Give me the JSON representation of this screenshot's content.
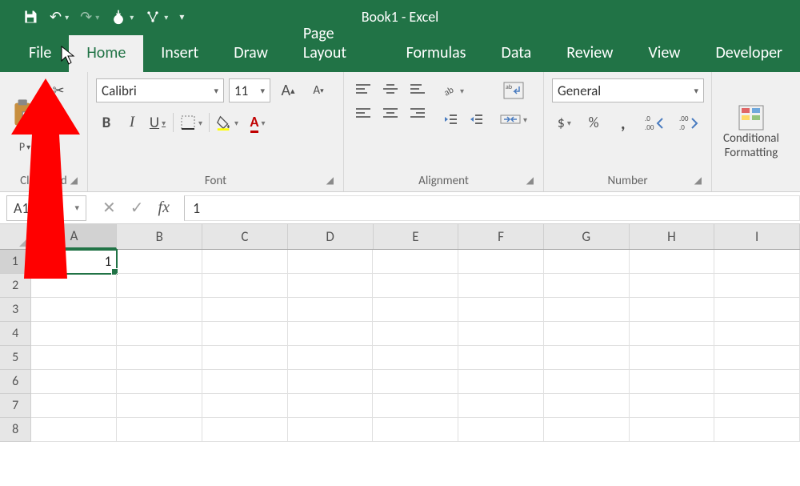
{
  "app": {
    "title": "Book1  -  Excel"
  },
  "tabs": {
    "file": "File",
    "list": [
      "Home",
      "Insert",
      "Draw",
      "Page Layout",
      "Formulas",
      "Data",
      "Review",
      "View",
      "Developer"
    ],
    "active": "Home"
  },
  "ribbon": {
    "clipboard": {
      "label": "Clipboard"
    },
    "font": {
      "label": "Font",
      "name": "Calibri",
      "size": "11",
      "increase": "A",
      "decrease": "A",
      "bold": "B",
      "italic": "I",
      "underline": "U"
    },
    "alignment": {
      "label": "Alignment"
    },
    "number": {
      "label": "Number",
      "format": "General",
      "currency": "$",
      "percent": "%",
      "comma": ",",
      "inc": ".0←.00",
      "dec": ".00→.0"
    },
    "styles": {
      "cf_line1": "Conditional",
      "cf_line2": "Formatting"
    }
  },
  "formula_bar": {
    "name": "A1",
    "cancel": "✕",
    "enter": "✓",
    "fx": "fx",
    "value": "1"
  },
  "grid": {
    "columns": [
      "A",
      "B",
      "C",
      "D",
      "E",
      "F",
      "G",
      "H",
      "I"
    ],
    "rows": [
      "1",
      "2",
      "3",
      "4",
      "5",
      "6",
      "7",
      "8"
    ],
    "cells": {
      "A1": "1"
    },
    "selected_col": "A",
    "selected_row": "1"
  }
}
